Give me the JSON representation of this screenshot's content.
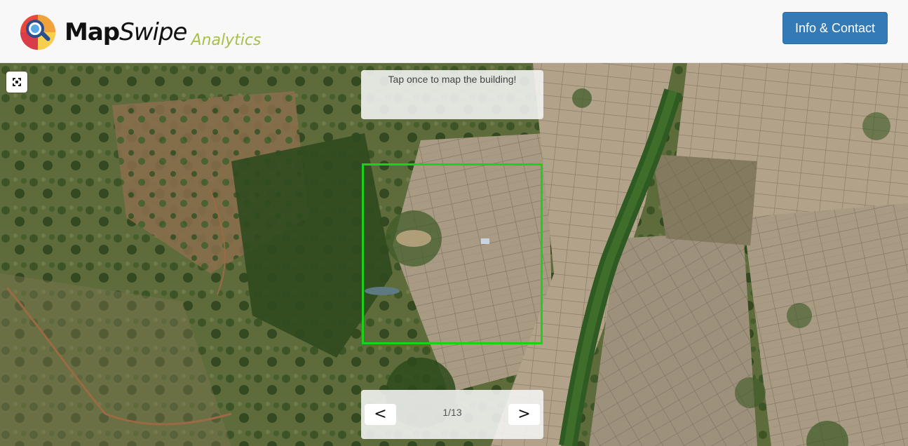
{
  "header": {
    "brand_map": "Map",
    "brand_swipe": "Swipe",
    "brand_analytics": "Analytics",
    "info_button_label": "Info & Contact"
  },
  "map": {
    "instruction": "Tap once to map the building!",
    "pager": {
      "prev_label": "<",
      "next_label": ">",
      "counter": "1/13"
    },
    "icons": {
      "fullscreen": "fullscreen-icon"
    }
  },
  "colors": {
    "accent_button": "#337ab7",
    "target_outline": "#19d319",
    "analytics_green": "#a6c04a"
  }
}
